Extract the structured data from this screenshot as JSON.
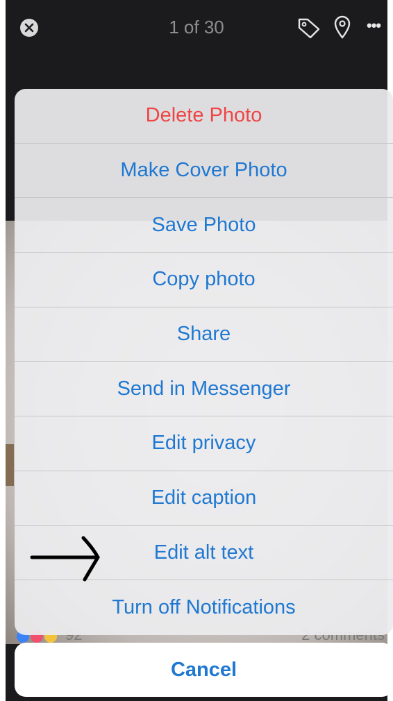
{
  "header": {
    "counter": "1 of 30",
    "icons": [
      "close-icon",
      "tag-icon",
      "location-pin-icon",
      "more-icon"
    ]
  },
  "post_footer": {
    "reaction_count": "92",
    "comments": "2 comments"
  },
  "action_sheet": {
    "items": [
      {
        "label": "Delete Photo",
        "style": "destructive"
      },
      {
        "label": "Make Cover Photo",
        "style": "default"
      },
      {
        "label": "Save Photo",
        "style": "default"
      },
      {
        "label": "Copy photo",
        "style": "default"
      },
      {
        "label": "Share",
        "style": "default"
      },
      {
        "label": "Send in Messenger",
        "style": "default"
      },
      {
        "label": "Edit privacy",
        "style": "default"
      },
      {
        "label": "Edit caption",
        "style": "default"
      },
      {
        "label": "Edit alt text",
        "style": "default"
      },
      {
        "label": "Turn off Notifications",
        "style": "default"
      }
    ],
    "cancel_label": "Cancel"
  },
  "colors": {
    "action_blue": "#1f78d1",
    "destructive_red": "#ee4545",
    "dark_background": "#1b1b1d"
  },
  "annotation": {
    "icon": "arrow-right-icon"
  }
}
